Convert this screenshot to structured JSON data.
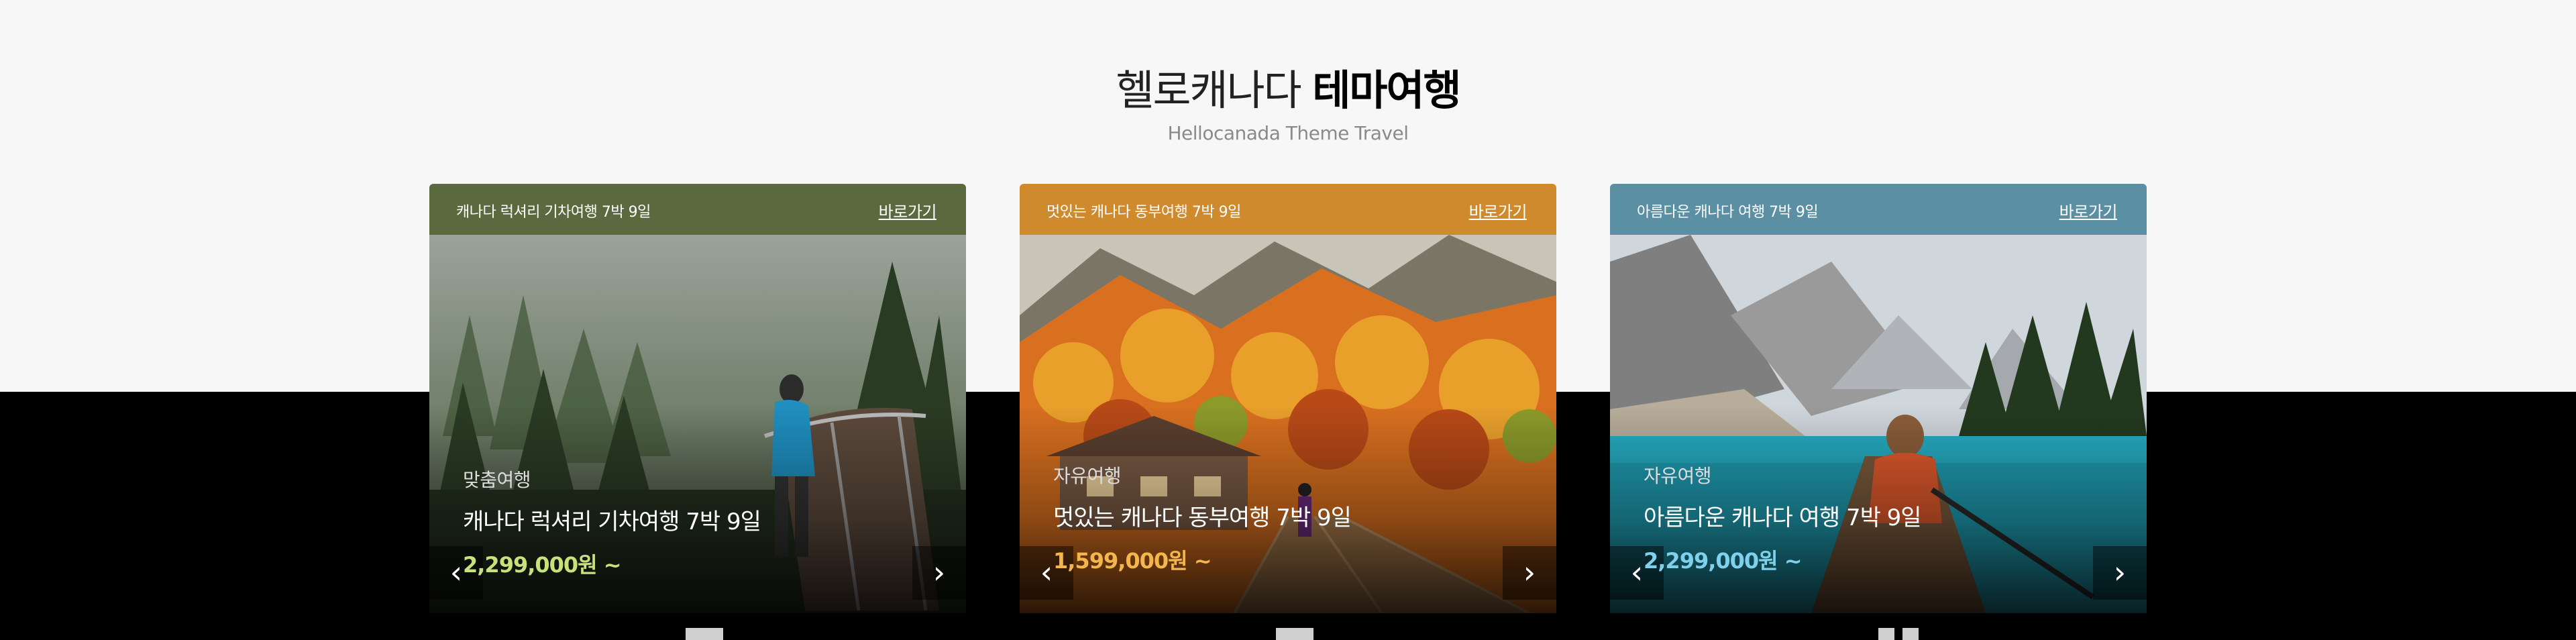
{
  "section": {
    "title_light": "헬로캐나다",
    "title_bold": "테마여행",
    "subtitle": "Hellocanada Theme Travel"
  },
  "cards": [
    {
      "header_title": "캐나다 럭셔리 기차여행 7박 9일",
      "link_label": "바로가기",
      "category": "맞춤여행",
      "title": "캐나다 럭셔리 기차여행 7박 9일",
      "price": "2,299,000원 ~",
      "header_color": "#5a6a3e",
      "price_color": "#c8e27a"
    },
    {
      "header_title": "멋있는 캐나다 동부여행 7박 9일",
      "link_label": "바로가기",
      "category": "자유여행",
      "title": "멋있는 캐나다 동부여행 7박 9일",
      "price": "1,599,000원 ~",
      "header_color": "#cf8a2e",
      "price_color": "#f2b64c"
    },
    {
      "header_title": "아름다운 캐나다 여행 7박 9일",
      "link_label": "바로가기",
      "category": "자유여행",
      "title": "아름다운 캐나다 여행 7박 9일",
      "price": "2,299,000원 ~",
      "header_color": "#5b8fa3",
      "price_color": "#7fd0ea"
    }
  ],
  "icons": {
    "prev": "chevron-left-icon",
    "next": "chevron-right-icon"
  }
}
